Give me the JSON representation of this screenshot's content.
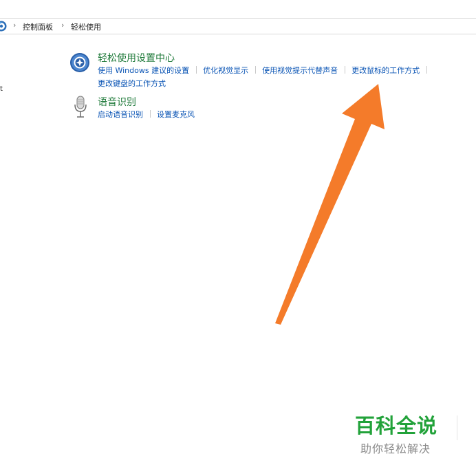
{
  "breadcrumb": {
    "items": [
      "控制面板",
      "轻松使用"
    ],
    "separator": "›"
  },
  "sidebar": {
    "stub_text": "t"
  },
  "sections": [
    {
      "title": "轻松使用设置中心",
      "icon": "ease-of-access-icon",
      "links": [
        "使用 Windows 建议的设置",
        "优化视觉显示",
        "使用视觉提示代替声音",
        "更改鼠标的工作方式"
      ],
      "links_row2": [
        "更改键盘的工作方式"
      ]
    },
    {
      "title": "语音识别",
      "icon": "microphone-icon",
      "links": [
        "启动语音识别",
        "设置麦克风"
      ]
    }
  ],
  "watermark": {
    "title": "百科全说",
    "subtitle": "助你轻松解决"
  },
  "colors": {
    "section_title": "#1f7a3a",
    "link": "#0b55b5",
    "arrow": "#f47b2a",
    "watermark": "#22a23a"
  }
}
